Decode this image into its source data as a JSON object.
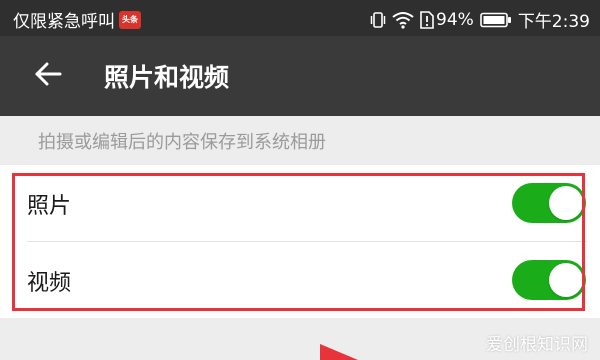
{
  "status_bar": {
    "emergency_text": "仅限紧急呼叫",
    "app_badge_text": "头条",
    "battery_percent": "94%",
    "time": "下午2:39"
  },
  "toolbar": {
    "back_icon": "back-arrow-icon",
    "title": "照片和视频"
  },
  "section": {
    "description": "拍摄或编辑后的内容保存到系统相册"
  },
  "settings": {
    "rows": [
      {
        "label": "照片",
        "enabled": true
      },
      {
        "label": "视频",
        "enabled": true
      }
    ]
  },
  "watermark": "爱创根知识网",
  "colors": {
    "status_bar_bg": "#2f2f2f",
    "toolbar_bg": "#3a3a3a",
    "toggle_on": "#1aac19",
    "highlight_border": "#e8333a",
    "page_bg": "#ededed"
  }
}
